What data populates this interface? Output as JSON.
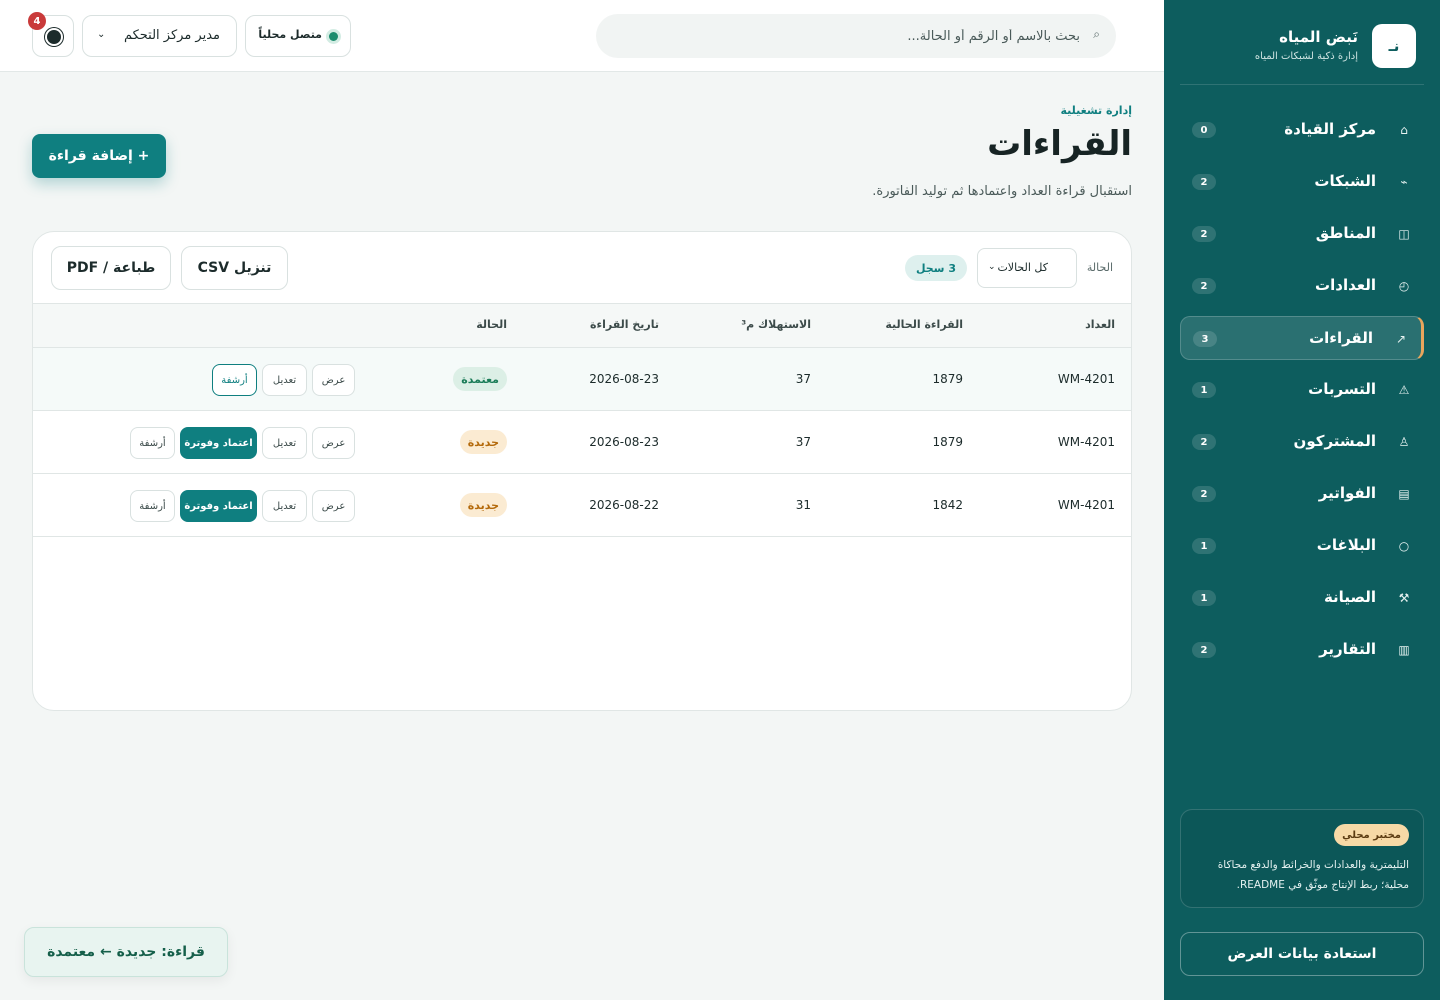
{
  "brand": {
    "logo_text": "نـ",
    "name": "نَبض المياه",
    "tagline": "إدارة ذكية لشبكات المياه"
  },
  "sidebar": {
    "items": [
      {
        "label": "مركز القيادة",
        "count": "0",
        "icon": "⌂",
        "icon_name": "home-icon",
        "active": false
      },
      {
        "label": "الشبكات",
        "count": "2",
        "icon": "⌁",
        "icon_name": "network-icon",
        "active": false
      },
      {
        "label": "المناطق",
        "count": "2",
        "icon": "◫",
        "icon_name": "map-icon",
        "active": false
      },
      {
        "label": "العدادات",
        "count": "2",
        "icon": "◴",
        "icon_name": "meter-icon",
        "active": false
      },
      {
        "label": "القراءات",
        "count": "3",
        "icon": "↗",
        "icon_name": "readings-icon",
        "active": true
      },
      {
        "label": "التسربات",
        "count": "1",
        "icon": "⚠",
        "icon_name": "warning-icon",
        "active": false
      },
      {
        "label": "المشتركون",
        "count": "2",
        "icon": "♙",
        "icon_name": "subscribers-icon",
        "active": false
      },
      {
        "label": "الفواتير",
        "count": "2",
        "icon": "▤",
        "icon_name": "invoice-icon",
        "active": false
      },
      {
        "label": "البلاغات",
        "count": "1",
        "icon": "○",
        "icon_name": "report-icon",
        "active": false
      },
      {
        "label": "الصيانة",
        "count": "1",
        "icon": "⚒",
        "icon_name": "maintenance-icon",
        "active": false
      },
      {
        "label": "التقارير",
        "count": "2",
        "icon": "▥",
        "icon_name": "reports-icon",
        "active": false
      }
    ],
    "lab": {
      "badge": "مختبر محلي",
      "text": "التليمترية والعدادات والخرائط والدفع محاكاة محلية؛ ربط الإنتاج موثّق في README."
    },
    "restore_label": "استعادة بيانات العرض"
  },
  "topbar": {
    "search_placeholder": "بحث بالاسم أو الرقم أو الحالة...",
    "search_value": "",
    "connection_status": "متصل محلياً",
    "role": "مدير مركز التحكم",
    "notifications_count": "4"
  },
  "page": {
    "eyebrow": "إدارة تشغيلية",
    "title": "القراءات",
    "subtitle": "استقبال قراءة العداد واعتمادها ثم توليد الفاتورة.",
    "add_button": "+ إضافة قراءة"
  },
  "toolbar": {
    "status_label": "الحالة",
    "status_value": "كل الحالات",
    "record_count": "3 سجل",
    "csv_button": "تنزيل CSV",
    "pdf_button": "طباعة / PDF"
  },
  "table": {
    "headers": {
      "meter": "العداد",
      "current": "القراءة الحالية",
      "usage": "الاستهلاك م³",
      "date": "تاريخ القراءة",
      "status": "الحالة"
    },
    "rows": [
      {
        "meter": "WM-4201",
        "current": "1879",
        "usage": "37",
        "date": "2026-08-23",
        "status": "معتمدة",
        "view": "عرض",
        "edit": "تعديل",
        "archive": "أرشفة"
      },
      {
        "meter": "WM-4201",
        "current": "1879",
        "usage": "37",
        "date": "2026-08-23",
        "status": "جديدة",
        "view": "عرض",
        "edit": "تعديل",
        "approve": "اعتماد وفوترة",
        "archive": "أرشفة"
      },
      {
        "meter": "WM-4201",
        "current": "1842",
        "usage": "31",
        "date": "2026-08-22",
        "status": "جديدة",
        "view": "عرض",
        "edit": "تعديل",
        "approve": "اعتماد وفوترة",
        "archive": "أرشفة"
      }
    ]
  },
  "toast": {
    "text": "قراءة: جديدة ← معتمدة"
  },
  "colors": {
    "primary": "#0f7f80",
    "sidebar_bg": "#0d5d5e",
    "active_accent": "#e8a55c",
    "approved": "#1b7c58",
    "new": "#b46a0c",
    "notification": "#c93a3a"
  }
}
